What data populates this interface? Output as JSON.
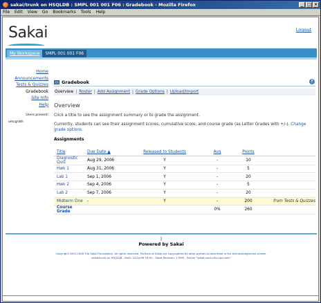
{
  "window": {
    "title": "sakai/trunk on HSQLDB : SMPL 001 001 F06 : Gradebook - Mozilla Firefox"
  },
  "menu": [
    "File",
    "Edit",
    "View",
    "Go",
    "Bookmarks",
    "Tools",
    "Help"
  ],
  "header": {
    "logo": "Sakai",
    "logout": "Logout"
  },
  "sites": {
    "my_workspace": "My Workspace",
    "current_site": "SMPL 001 001 F06"
  },
  "sidebar": {
    "items": [
      {
        "label": "Home"
      },
      {
        "label": "Announcements"
      },
      {
        "label": "Tests & Quizzes"
      },
      {
        "label": "Gradebook"
      },
      {
        "label": "Site Info"
      },
      {
        "label": "Help"
      }
    ],
    "users_present": "Users present:",
    "user": "omcgrath"
  },
  "tool": {
    "title": "Gradebook",
    "help": "?",
    "nav": [
      "Overview",
      "Roster",
      "Add Assignment",
      "Grade Options",
      "Upload/Import"
    ]
  },
  "main": {
    "heading": "Overview",
    "intro": "Click a title to see the assignment summary or to grade the assignment.",
    "info_text": "Currently, students can see their assignment scores, cumulative score, and course grade (as Letter Grades with +/-).",
    "info_link": "Change grade options.",
    "assignments_heading": "Assignments"
  },
  "table": {
    "columns": [
      "Title",
      "Due Date ▲",
      "Released to Students",
      "Avg",
      "Points"
    ],
    "rows": [
      {
        "title": "Diagnostic Quiz",
        "due": "Aug 29, 2006",
        "released": "Y",
        "avg": "-",
        "points": "10",
        "note": ""
      },
      {
        "title": "Hwk 1",
        "due": "Aug 31, 2006",
        "released": "Y",
        "avg": "-",
        "points": "5",
        "note": ""
      },
      {
        "title": "Lab 1",
        "due": "Sep 1, 2006",
        "released": "Y",
        "avg": "-",
        "points": "20",
        "note": ""
      },
      {
        "title": "Hwk 2",
        "due": "Sep 4, 2006",
        "released": "Y",
        "avg": "-",
        "points": "5",
        "note": ""
      },
      {
        "title": "Lab 2",
        "due": "Sep 7, 2006",
        "released": "Y",
        "avg": "-",
        "points": "20",
        "note": ""
      },
      {
        "title": "Midterm One",
        "due": "-",
        "released": "Y",
        "avg": "-",
        "points": "200",
        "note": "from Tests & Quizzes"
      }
    ],
    "course_grade": {
      "title": "Course Grade",
      "avg": "0%",
      "points": "260"
    }
  },
  "footer": {
    "pipe": "|",
    "powered": "Powered by Sakai",
    "copyright": "Copyright 2003-2006 The Sakai Foundation. All rights reserved. Portions of Sakai are copyrighted by other parties as described in the Acknowledgments screen.",
    "build": "sakai/trunk on HSQLDB - Built: 10/10/06 16:00 - Sakai Revision: 17085 - Server \"sakai-card.uits.iupui.edu\""
  }
}
